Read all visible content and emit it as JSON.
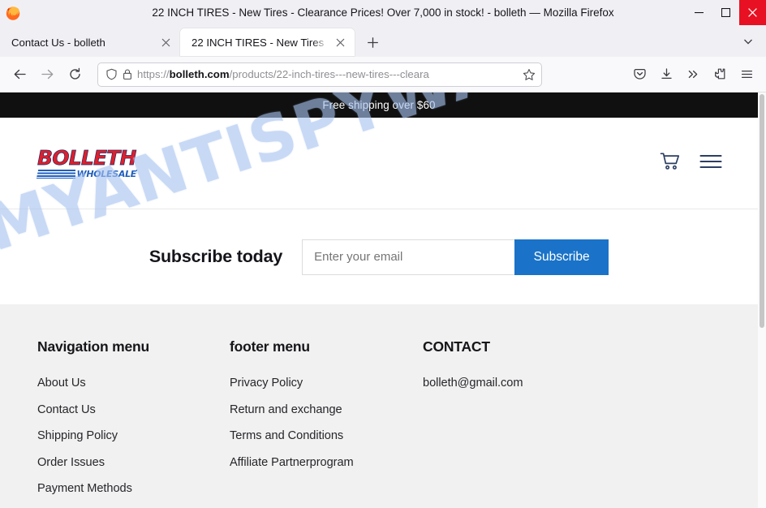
{
  "browser": {
    "window_title": "22 INCH TIRES - New Tires - Clearance Prices! Over 7,000 in stock! - bolleth — Mozilla Firefox",
    "window_controls": {
      "minimize": "minimize-icon",
      "maximize": "maximize-icon",
      "close": "close-icon"
    },
    "tabs": [
      {
        "label": "Contact Us - bolleth",
        "active": false
      },
      {
        "label": "22 INCH TIRES - New Tires",
        "active": true
      }
    ],
    "new_tab_label": "+",
    "tab_list_icon": "chevron-down-icon",
    "nav": {
      "back_icon": "back-arrow-icon",
      "forward_icon": "forward-arrow-icon",
      "reload_icon": "reload-icon",
      "shield_icon": "shield-icon",
      "lock_icon": "padlock-icon",
      "bookmark_icon": "star-icon"
    },
    "url": {
      "scheme": "https://",
      "host": "bolleth.com",
      "path": "/products/22-inch-tires---new-tires---cleara",
      "full": "https://bolleth.com/products/22-inch-tires---new-tires---cleara"
    },
    "toolbar_right": [
      {
        "icon": "pocket-icon"
      },
      {
        "icon": "download-icon"
      },
      {
        "icon": "overflow-chevrons-icon"
      },
      {
        "icon": "extensions-puzzle-icon"
      },
      {
        "icon": "app-menu-hamburger-icon"
      }
    ]
  },
  "page": {
    "announcement": "Free shipping over $60",
    "logo": {
      "word": "BOLLETH",
      "subword": "WHOLESALE"
    },
    "header_icons": [
      {
        "name": "cart-icon"
      },
      {
        "name": "menu-hamburger-icon"
      }
    ],
    "subscribe": {
      "title": "Subscribe today",
      "placeholder": "Enter your email",
      "value": "",
      "button": "Subscribe",
      "button_color": "#1a73c8"
    },
    "footer": {
      "columns": [
        {
          "heading": "Navigation menu",
          "links": [
            "About Us",
            "Contact Us",
            "Shipping Policy",
            "Order Issues",
            "Payment Methods"
          ]
        },
        {
          "heading": "footer menu",
          "links": [
            "Privacy Policy",
            "Return and exchange",
            "Terms and Conditions",
            "Affiliate Partnerprogram"
          ]
        },
        {
          "heading": "CONTACT",
          "links": [
            "bolleth@gmail.com"
          ]
        }
      ]
    },
    "watermark": "MYANTISPYWARE.COM"
  }
}
